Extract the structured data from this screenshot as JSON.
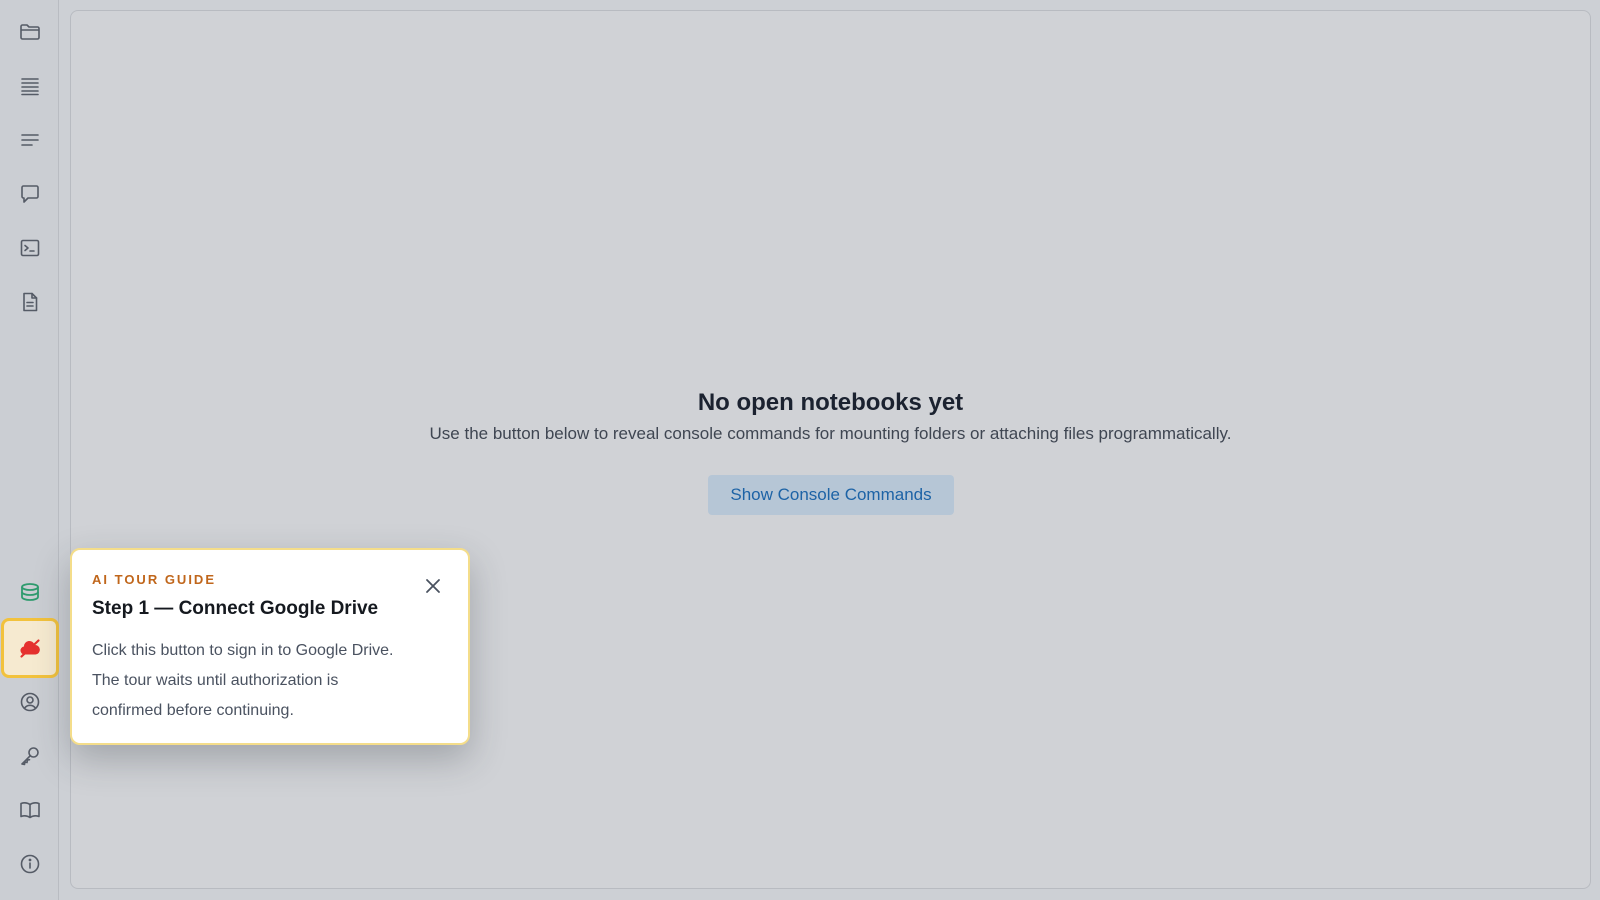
{
  "sidebar": {
    "top_items": [
      {
        "icon": "folder-icon"
      },
      {
        "icon": "list-icon"
      },
      {
        "icon": "lines-icon"
      },
      {
        "icon": "chat-icon"
      },
      {
        "icon": "terminal-icon"
      },
      {
        "icon": "document-icon"
      }
    ],
    "bottom_items": [
      {
        "icon": "database-icon",
        "color": "#2f9b6e"
      },
      {
        "icon": "cloud-off-icon",
        "color": "#e5312e",
        "highlighted": true
      },
      {
        "icon": "account-icon"
      },
      {
        "icon": "key-icon"
      },
      {
        "icon": "book-icon"
      },
      {
        "icon": "info-icon"
      }
    ]
  },
  "main": {
    "title": "No open notebooks yet",
    "subtitle": "Use the button below to reveal console commands for mounting folders or attaching files programmatically.",
    "button_label": "Show Console Commands"
  },
  "tour": {
    "kicker": "AI TOUR GUIDE",
    "title": "Step 1 — Connect Google Drive",
    "body": "Click this button to sign in to Google Drive. The tour waits until authorization is confirmed before continuing.",
    "close_icon": "close-icon",
    "accent_color": "#c0661b",
    "highlight_color": "#f2c23d"
  },
  "colors": {
    "background": "#cdd0d5",
    "button_bg": "#b6c6d6",
    "button_text": "#1d63a6"
  }
}
